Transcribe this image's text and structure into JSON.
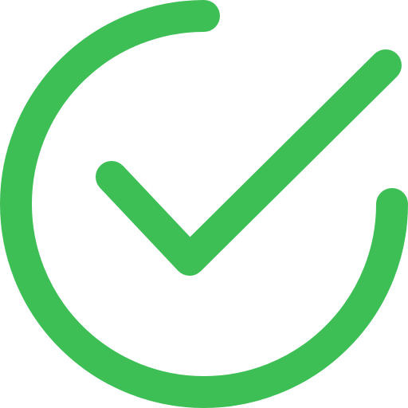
{
  "icon": {
    "name": "check-circle-icon",
    "color": "#3dbf56",
    "background": "#ffffff"
  }
}
